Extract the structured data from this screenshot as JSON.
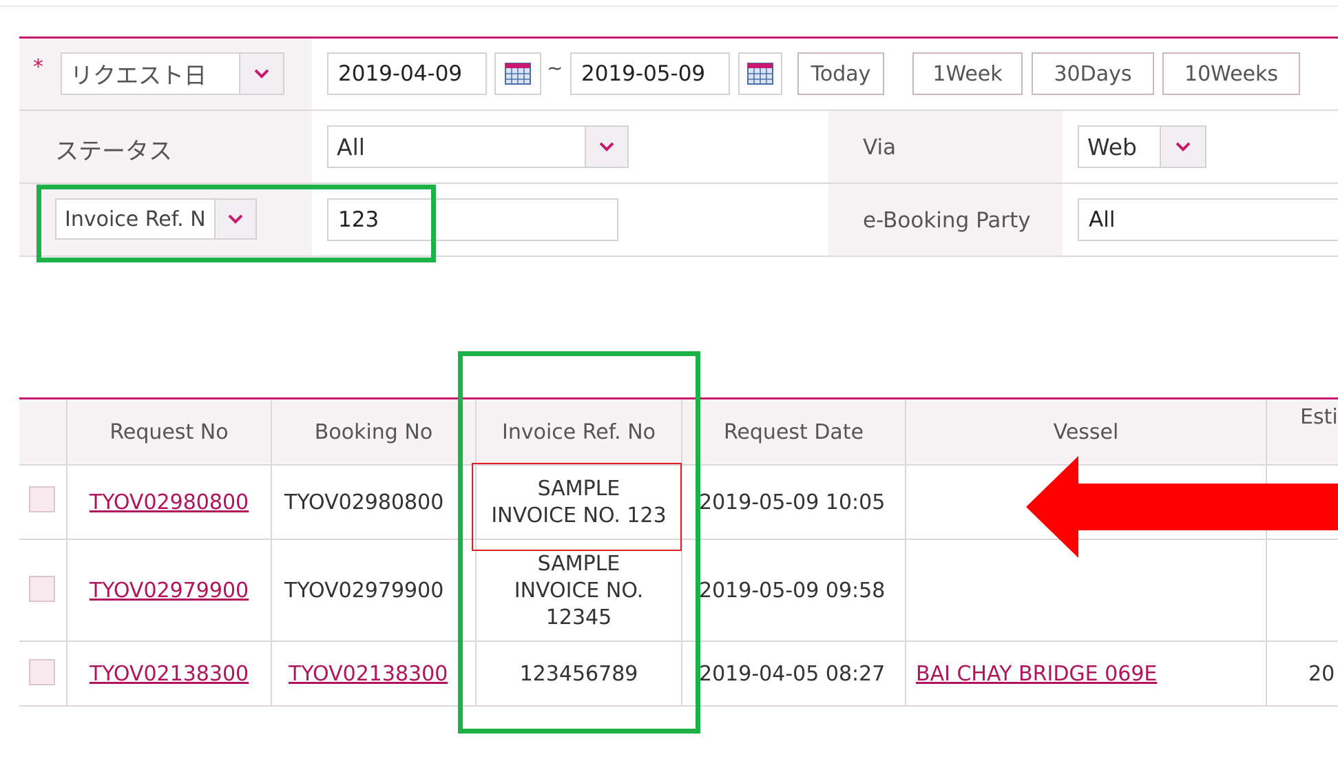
{
  "filters": {
    "required_mark": "*",
    "date_type": "リクエスト日",
    "date_from": "2019-04-09",
    "date_separator": "~",
    "date_to": "2019-05-09",
    "quick_ranges": [
      "Today",
      "1Week",
      "30Days",
      "10Weeks"
    ],
    "status_label": "ステータス",
    "status_value": "All",
    "via_label": "Via",
    "via_value": "Web",
    "ref_type": "Invoice Ref. N",
    "ref_value": "123",
    "ebooking_label": "e-Booking Party",
    "ebooking_value": "All"
  },
  "table": {
    "headers": [
      "Request No",
      "Booking No",
      "Invoice Ref. No",
      "Request Date",
      "Vessel",
      "Esti"
    ],
    "rows": [
      {
        "request_no": "TYOV02980800",
        "booking_no": "TYOV02980800",
        "invoice_ref": "SAMPLE\nINVOICE NO. 123",
        "request_date": "2019-05-09 10:05",
        "vessel": "",
        "est": ""
      },
      {
        "request_no": "TYOV02979900",
        "booking_no": "TYOV02979900",
        "invoice_ref": "SAMPLE\nINVOICE NO.\n12345",
        "request_date": "2019-05-09 09:58",
        "vessel": "",
        "est": ""
      },
      {
        "request_no": "TYOV02138300",
        "booking_no": "TYOV02138300",
        "invoice_ref": "123456789",
        "request_date": "2019-04-05 08:27",
        "vessel": "BAI CHAY BRIDGE 069E",
        "est": "20"
      }
    ]
  },
  "colors": {
    "accent": "#c8196e",
    "highlight_green": "#1db247",
    "highlight_red": "#e02020",
    "arrow": "#ff0000"
  }
}
